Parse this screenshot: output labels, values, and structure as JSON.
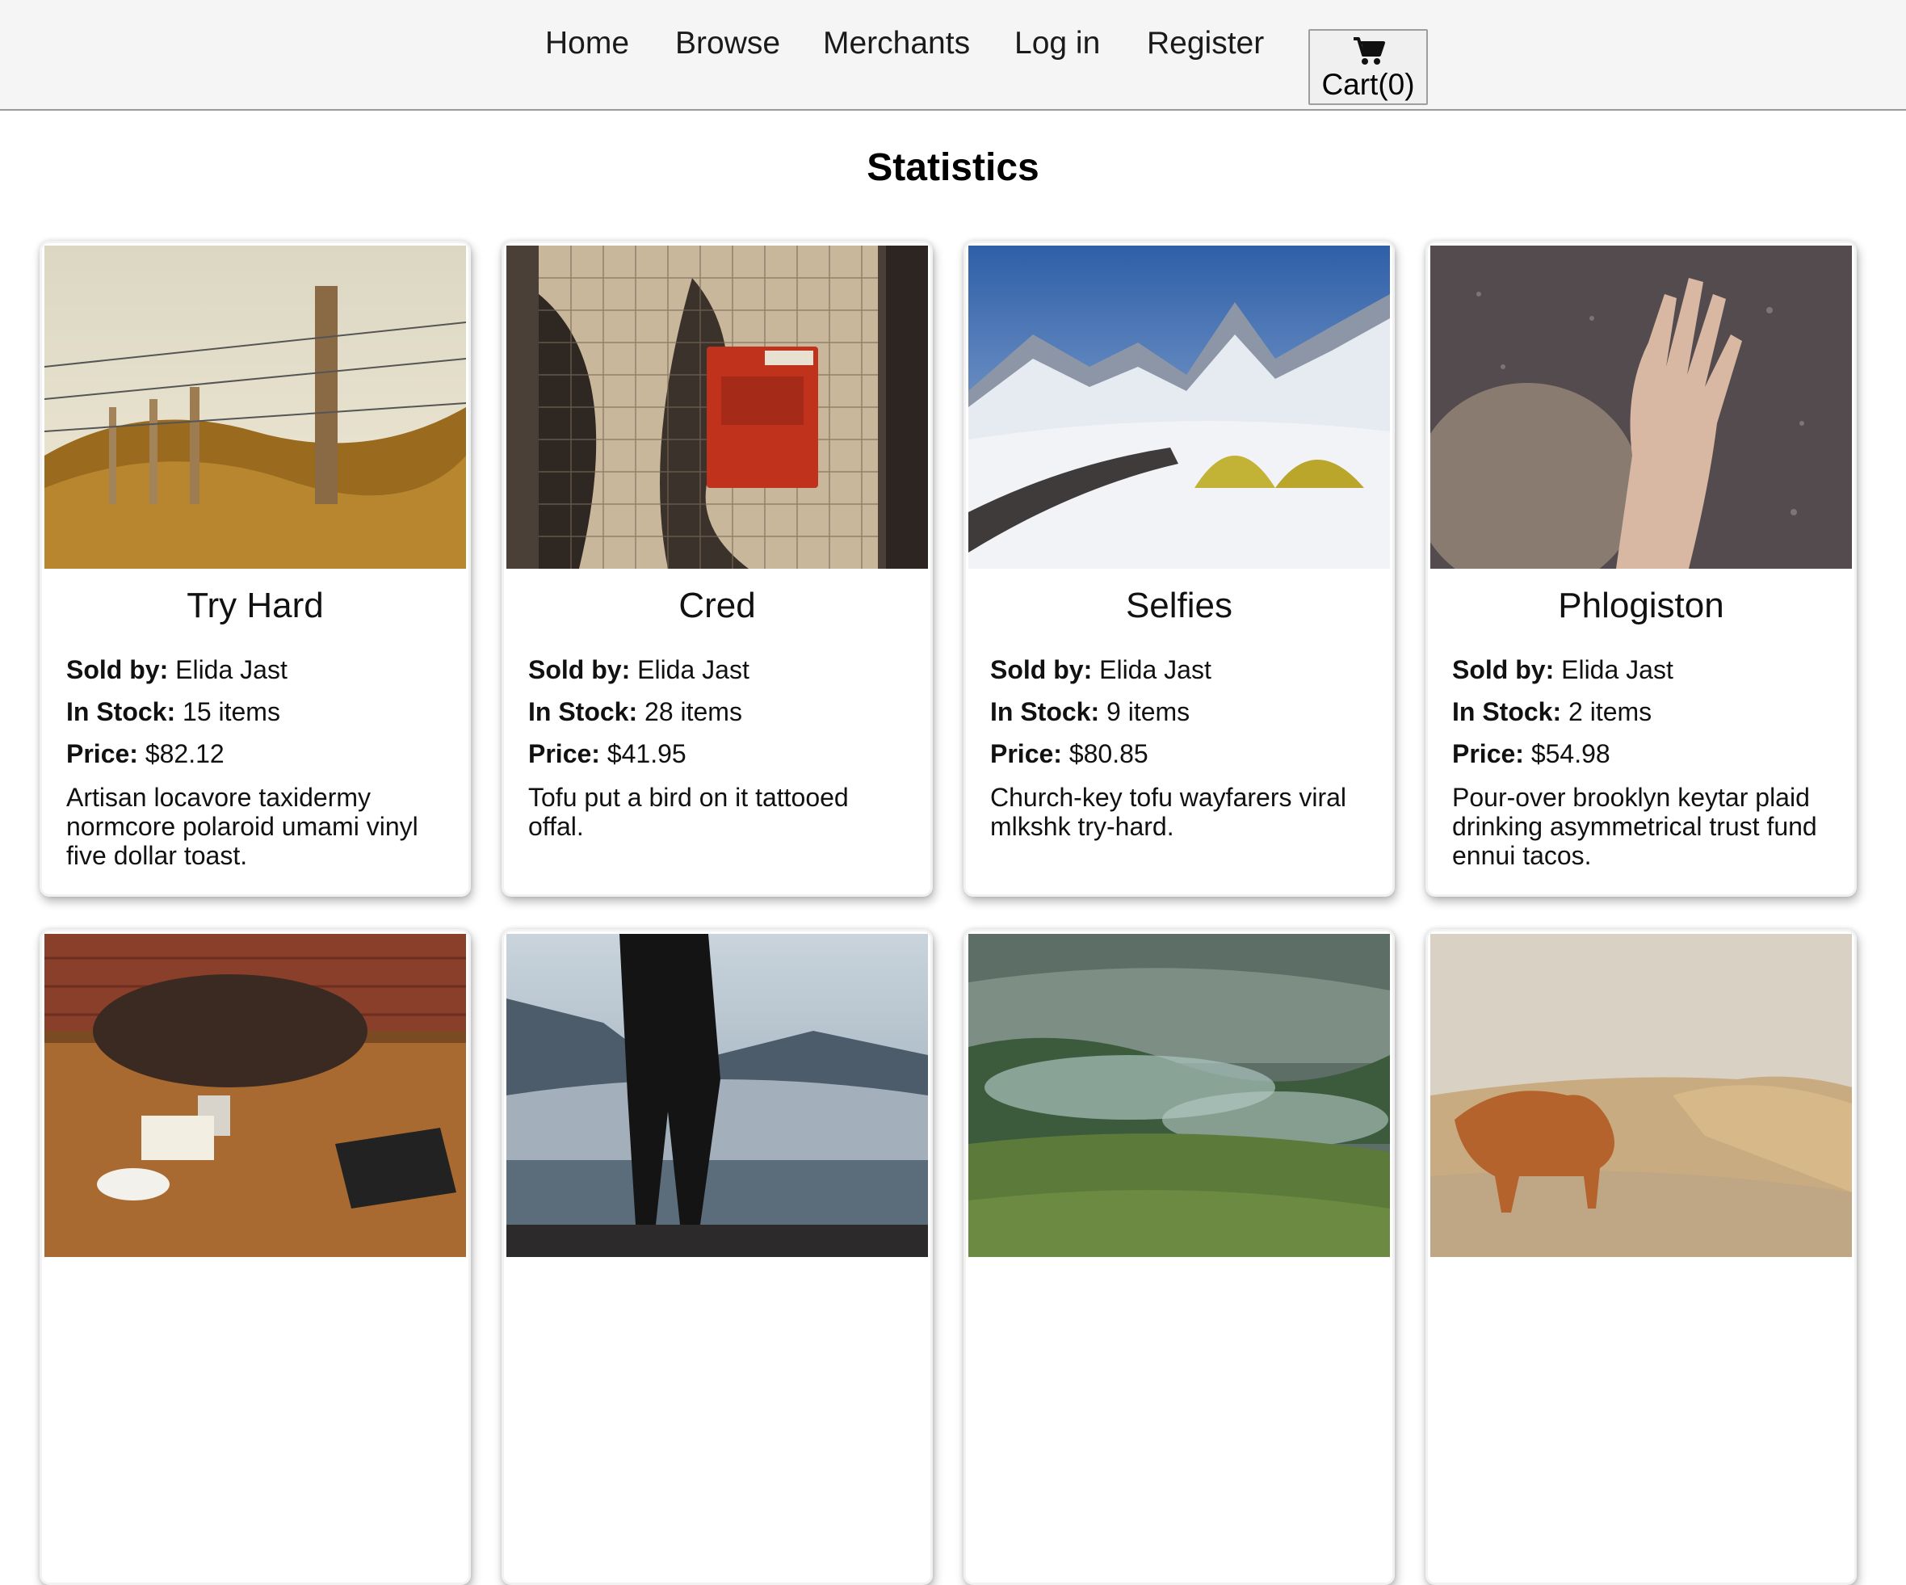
{
  "nav": {
    "home": "Home",
    "browse": "Browse",
    "merchants": "Merchants",
    "login": "Log in",
    "register": "Register",
    "cart": "Cart(0)"
  },
  "page": {
    "title": "Statistics"
  },
  "labels": {
    "sold_by": "Sold by:",
    "in_stock": "In Stock:",
    "price": "Price:"
  },
  "products": [
    {
      "name": "Try Hard",
      "seller": "Elida Jast",
      "stock": "15 items",
      "price": "$82.12",
      "description": "Artisan locavore taxidermy normcore polaroid umami vinyl five dollar toast."
    },
    {
      "name": "Cred",
      "seller": "Elida Jast",
      "stock": "28 items",
      "price": "$41.95",
      "description": "Tofu put a bird on it tattooed offal."
    },
    {
      "name": "Selfies",
      "seller": "Elida Jast",
      "stock": "9 items",
      "price": "$80.85",
      "description": "Church-key tofu wayfarers viral mlkshk try-hard."
    },
    {
      "name": "Phlogiston",
      "seller": "Elida Jast",
      "stock": "2 items",
      "price": "$54.98",
      "description": "Pour-over brooklyn keytar plaid drinking asymmetrical trust fund ennui tacos."
    },
    {
      "name": "",
      "seller": "",
      "stock": "",
      "price": "",
      "description": ""
    },
    {
      "name": "",
      "seller": "",
      "stock": "",
      "price": "",
      "description": ""
    },
    {
      "name": "",
      "seller": "",
      "stock": "",
      "price": "",
      "description": ""
    },
    {
      "name": "",
      "seller": "",
      "stock": "",
      "price": "",
      "description": ""
    }
  ]
}
